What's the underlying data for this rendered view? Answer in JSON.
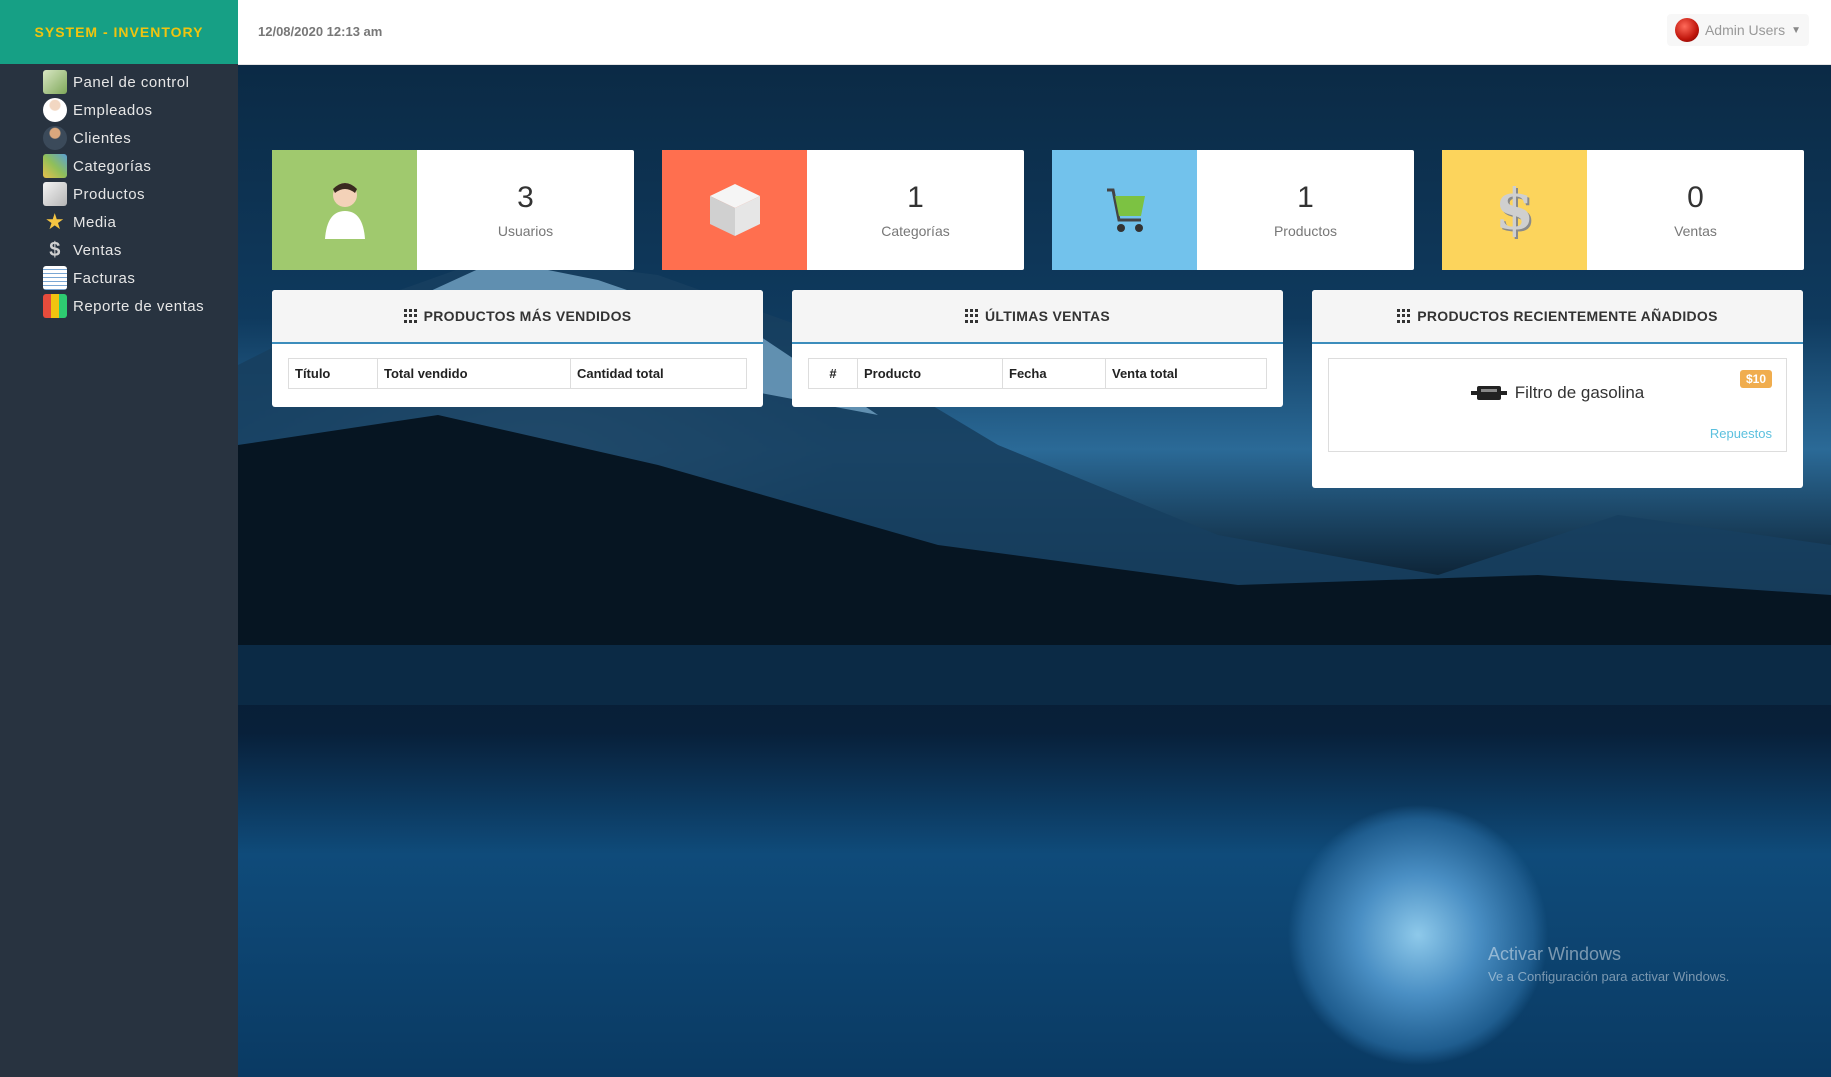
{
  "app": {
    "brand": "SYSTEM - INVENTORY",
    "accent": "#16a085",
    "brand_text_color": "#f1c40f"
  },
  "sidebar": {
    "items": [
      {
        "label": "Panel de control",
        "icon": "dashboard-icon"
      },
      {
        "label": "Empleados",
        "icon": "employee-icon"
      },
      {
        "label": "Clientes",
        "icon": "client-icon"
      },
      {
        "label": "Categorías",
        "icon": "category-icon"
      },
      {
        "label": "Productos",
        "icon": "product-icon"
      },
      {
        "label": "Media",
        "icon": "star-icon"
      },
      {
        "label": "Ventas",
        "icon": "sales-icon"
      },
      {
        "label": "Facturas",
        "icon": "invoice-icon"
      },
      {
        "label": "Reporte de ventas",
        "icon": "report-icon"
      }
    ]
  },
  "header": {
    "datetime": "12/08/2020 12:13 am",
    "user": "Admin Users"
  },
  "stats": [
    {
      "value": "3",
      "label": "Usuarios",
      "icon": "user-icon",
      "color": "#a0c96e"
    },
    {
      "value": "1",
      "label": "Categorías",
      "icon": "box-icon",
      "color": "#ff6f4f"
    },
    {
      "value": "1",
      "label": "Productos",
      "icon": "cart-icon",
      "color": "#72c2ec"
    },
    {
      "value": "0",
      "label": "Ventas",
      "icon": "dollar-icon",
      "color": "#fcd45c"
    }
  ],
  "panels": {
    "best_sellers": {
      "title": "PRODUCTOS MÁS VENDIDOS",
      "columns": [
        "Título",
        "Total vendido",
        "Cantidad total"
      ]
    },
    "latest_sales": {
      "title": "ÚLTIMAS VENTAS",
      "columns": [
        "#",
        "Producto",
        "Fecha",
        "Venta total"
      ]
    },
    "recent_products": {
      "title": "PRODUCTOS RECIENTEMENTE AÑADIDOS",
      "items": [
        {
          "name": "Filtro de gasolina",
          "price": "$10",
          "category": "Repuestos"
        }
      ]
    }
  },
  "watermark": {
    "line1": "Activar Windows",
    "line2": "Ve a Configuración para activar Windows."
  }
}
